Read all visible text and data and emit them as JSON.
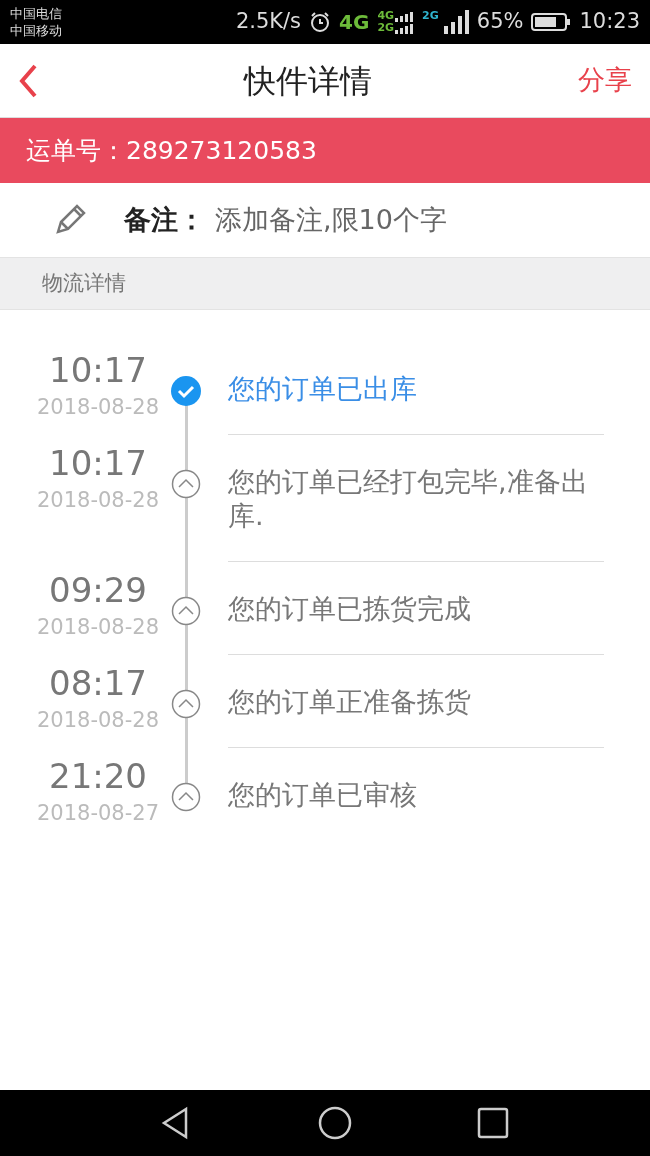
{
  "status_bar": {
    "carriers": [
      "中国电信",
      "中国移动"
    ],
    "speed": "2.5K/s",
    "network": "4G",
    "sim1": [
      "4G",
      "2G"
    ],
    "sim2": "2G",
    "battery": "65%",
    "time": "10:23"
  },
  "header": {
    "title": "快件详情",
    "action": "分享"
  },
  "waybill": {
    "label": "运单号：",
    "number": "289273120583"
  },
  "remark": {
    "label": "备注：",
    "placeholder": "添加备注,限10个字"
  },
  "section_title": "物流详情",
  "events": [
    {
      "time": "10:17",
      "date": "2018-08-28",
      "text": "您的订单已出库",
      "current": true
    },
    {
      "time": "10:17",
      "date": "2018-08-28",
      "text": "您的订单已经打包完毕,准备出库.",
      "current": false
    },
    {
      "time": "09:29",
      "date": "2018-08-28",
      "text": "您的订单已拣货完成",
      "current": false
    },
    {
      "time": "08:17",
      "date": "2018-08-28",
      "text": "您的订单正准备拣货",
      "current": false
    },
    {
      "time": "21:20",
      "date": "2018-08-27",
      "text": "您的订单已审核",
      "current": false
    }
  ]
}
